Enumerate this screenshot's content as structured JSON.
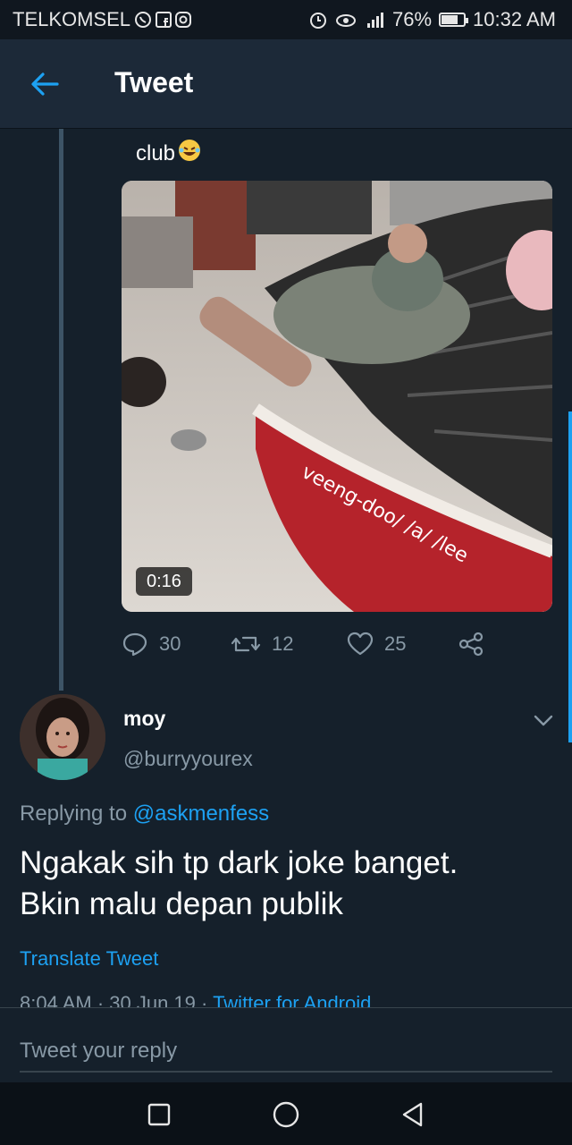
{
  "status_bar": {
    "carrier": "TELKOMSEL",
    "battery": "76%",
    "battery_level": 0.76,
    "time": "10:32 AM",
    "icons": [
      "whatsapp-icon",
      "facebook-icon",
      "instagram-icon",
      "alarm-icon",
      "eye-icon",
      "signal-icon",
      "battery-icon"
    ]
  },
  "header": {
    "title": "Tweet",
    "back_icon": "arrow-left-icon"
  },
  "quoted_tweet": {
    "text": "club",
    "emoji": "😂",
    "video": {
      "duration": "0:16",
      "overlay_text": "veeng-doo/ /a/ /lee"
    },
    "actions": {
      "replies": "30",
      "retweets": "12",
      "likes": "25"
    }
  },
  "reply_tweet": {
    "name": "moy",
    "handle": "@burryyourex",
    "replying_prefix": "Replying to",
    "replying_to": "@askmenfess",
    "text_line1": "Ngakak sih tp dark joke banget.",
    "text_line2": "Bkin malu depan publik",
    "translate_label": "Translate Tweet",
    "timestamp": "8:04 AM · 30 Jun 19 · ",
    "client": "Twitter for Android"
  },
  "reply_bar": {
    "placeholder": "Tweet your reply"
  },
  "colors": {
    "background": "#15202b",
    "header": "#1c2938",
    "accent": "#1da1f2",
    "secondary_text": "#8899a6"
  }
}
